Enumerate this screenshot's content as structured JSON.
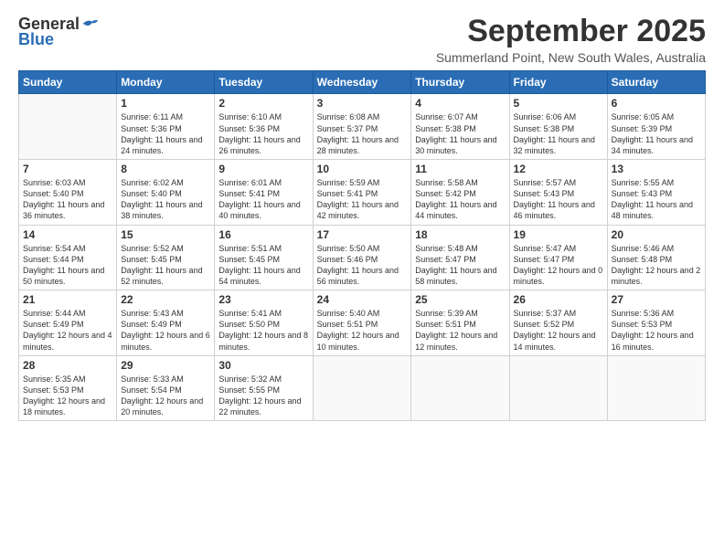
{
  "logo": {
    "line1": "General",
    "line2": "Blue"
  },
  "title": "September 2025",
  "subtitle": "Summerland Point, New South Wales, Australia",
  "weekdays": [
    "Sunday",
    "Monday",
    "Tuesday",
    "Wednesday",
    "Thursday",
    "Friday",
    "Saturday"
  ],
  "weeks": [
    [
      {
        "day": "",
        "info": ""
      },
      {
        "day": "1",
        "info": "Sunrise: 6:11 AM\nSunset: 5:36 PM\nDaylight: 11 hours\nand 24 minutes."
      },
      {
        "day": "2",
        "info": "Sunrise: 6:10 AM\nSunset: 5:36 PM\nDaylight: 11 hours\nand 26 minutes."
      },
      {
        "day": "3",
        "info": "Sunrise: 6:08 AM\nSunset: 5:37 PM\nDaylight: 11 hours\nand 28 minutes."
      },
      {
        "day": "4",
        "info": "Sunrise: 6:07 AM\nSunset: 5:38 PM\nDaylight: 11 hours\nand 30 minutes."
      },
      {
        "day": "5",
        "info": "Sunrise: 6:06 AM\nSunset: 5:38 PM\nDaylight: 11 hours\nand 32 minutes."
      },
      {
        "day": "6",
        "info": "Sunrise: 6:05 AM\nSunset: 5:39 PM\nDaylight: 11 hours\nand 34 minutes."
      }
    ],
    [
      {
        "day": "7",
        "info": "Sunrise: 6:03 AM\nSunset: 5:40 PM\nDaylight: 11 hours\nand 36 minutes."
      },
      {
        "day": "8",
        "info": "Sunrise: 6:02 AM\nSunset: 5:40 PM\nDaylight: 11 hours\nand 38 minutes."
      },
      {
        "day": "9",
        "info": "Sunrise: 6:01 AM\nSunset: 5:41 PM\nDaylight: 11 hours\nand 40 minutes."
      },
      {
        "day": "10",
        "info": "Sunrise: 5:59 AM\nSunset: 5:41 PM\nDaylight: 11 hours\nand 42 minutes."
      },
      {
        "day": "11",
        "info": "Sunrise: 5:58 AM\nSunset: 5:42 PM\nDaylight: 11 hours\nand 44 minutes."
      },
      {
        "day": "12",
        "info": "Sunrise: 5:57 AM\nSunset: 5:43 PM\nDaylight: 11 hours\nand 46 minutes."
      },
      {
        "day": "13",
        "info": "Sunrise: 5:55 AM\nSunset: 5:43 PM\nDaylight: 11 hours\nand 48 minutes."
      }
    ],
    [
      {
        "day": "14",
        "info": "Sunrise: 5:54 AM\nSunset: 5:44 PM\nDaylight: 11 hours\nand 50 minutes."
      },
      {
        "day": "15",
        "info": "Sunrise: 5:52 AM\nSunset: 5:45 PM\nDaylight: 11 hours\nand 52 minutes."
      },
      {
        "day": "16",
        "info": "Sunrise: 5:51 AM\nSunset: 5:45 PM\nDaylight: 11 hours\nand 54 minutes."
      },
      {
        "day": "17",
        "info": "Sunrise: 5:50 AM\nSunset: 5:46 PM\nDaylight: 11 hours\nand 56 minutes."
      },
      {
        "day": "18",
        "info": "Sunrise: 5:48 AM\nSunset: 5:47 PM\nDaylight: 11 hours\nand 58 minutes."
      },
      {
        "day": "19",
        "info": "Sunrise: 5:47 AM\nSunset: 5:47 PM\nDaylight: 12 hours\nand 0 minutes."
      },
      {
        "day": "20",
        "info": "Sunrise: 5:46 AM\nSunset: 5:48 PM\nDaylight: 12 hours\nand 2 minutes."
      }
    ],
    [
      {
        "day": "21",
        "info": "Sunrise: 5:44 AM\nSunset: 5:49 PM\nDaylight: 12 hours\nand 4 minutes."
      },
      {
        "day": "22",
        "info": "Sunrise: 5:43 AM\nSunset: 5:49 PM\nDaylight: 12 hours\nand 6 minutes."
      },
      {
        "day": "23",
        "info": "Sunrise: 5:41 AM\nSunset: 5:50 PM\nDaylight: 12 hours\nand 8 minutes."
      },
      {
        "day": "24",
        "info": "Sunrise: 5:40 AM\nSunset: 5:51 PM\nDaylight: 12 hours\nand 10 minutes."
      },
      {
        "day": "25",
        "info": "Sunrise: 5:39 AM\nSunset: 5:51 PM\nDaylight: 12 hours\nand 12 minutes."
      },
      {
        "day": "26",
        "info": "Sunrise: 5:37 AM\nSunset: 5:52 PM\nDaylight: 12 hours\nand 14 minutes."
      },
      {
        "day": "27",
        "info": "Sunrise: 5:36 AM\nSunset: 5:53 PM\nDaylight: 12 hours\nand 16 minutes."
      }
    ],
    [
      {
        "day": "28",
        "info": "Sunrise: 5:35 AM\nSunset: 5:53 PM\nDaylight: 12 hours\nand 18 minutes."
      },
      {
        "day": "29",
        "info": "Sunrise: 5:33 AM\nSunset: 5:54 PM\nDaylight: 12 hours\nand 20 minutes."
      },
      {
        "day": "30",
        "info": "Sunrise: 5:32 AM\nSunset: 5:55 PM\nDaylight: 12 hours\nand 22 minutes."
      },
      {
        "day": "",
        "info": ""
      },
      {
        "day": "",
        "info": ""
      },
      {
        "day": "",
        "info": ""
      },
      {
        "day": "",
        "info": ""
      }
    ]
  ]
}
